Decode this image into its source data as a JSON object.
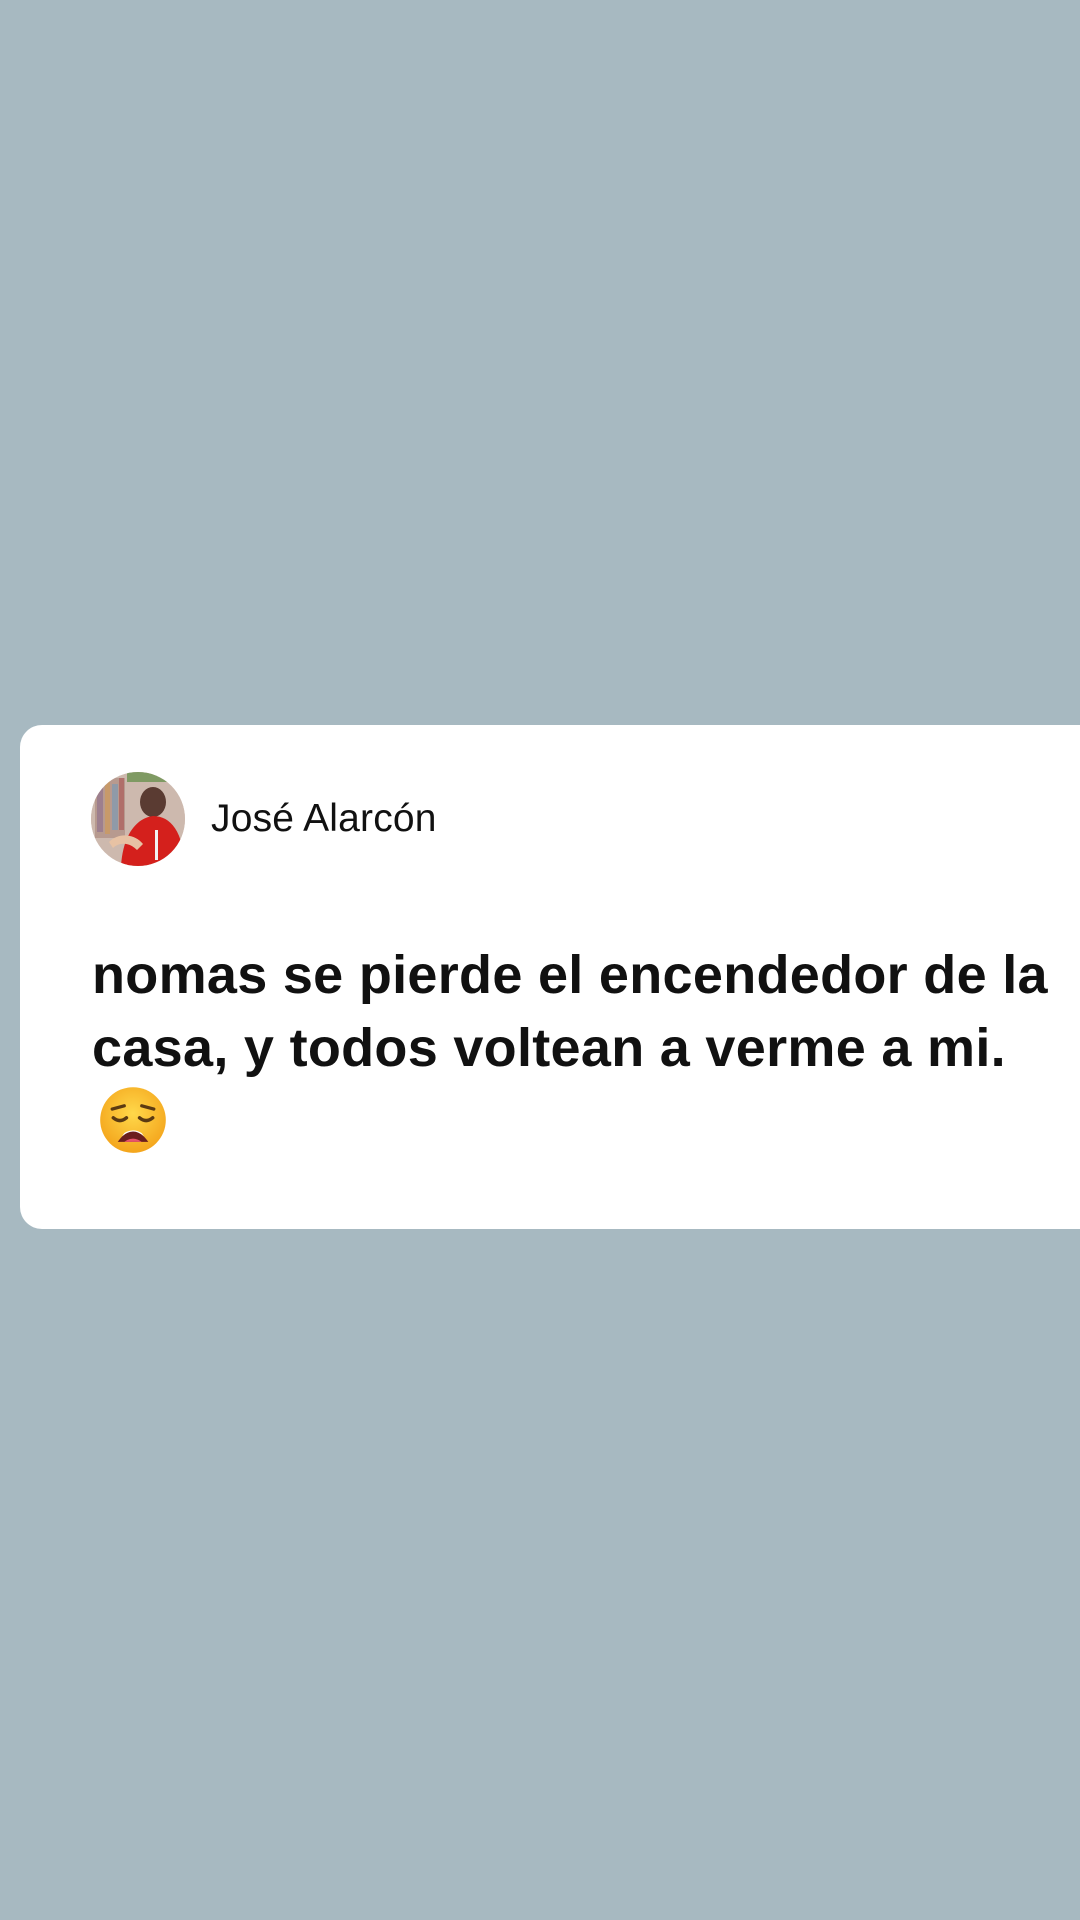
{
  "colors": {
    "background": "#a7b9c1",
    "card": "#ffffff",
    "text": "#111111",
    "avatar_shirt": "#d4201c"
  },
  "post": {
    "author": {
      "name": "José Alarcón",
      "avatar_icon": "profile-photo"
    },
    "text": "nomas se pierde el encendedor de la casa, y todos voltean a verme a mi.",
    "emoji_icon": "weary-face-emoji"
  }
}
